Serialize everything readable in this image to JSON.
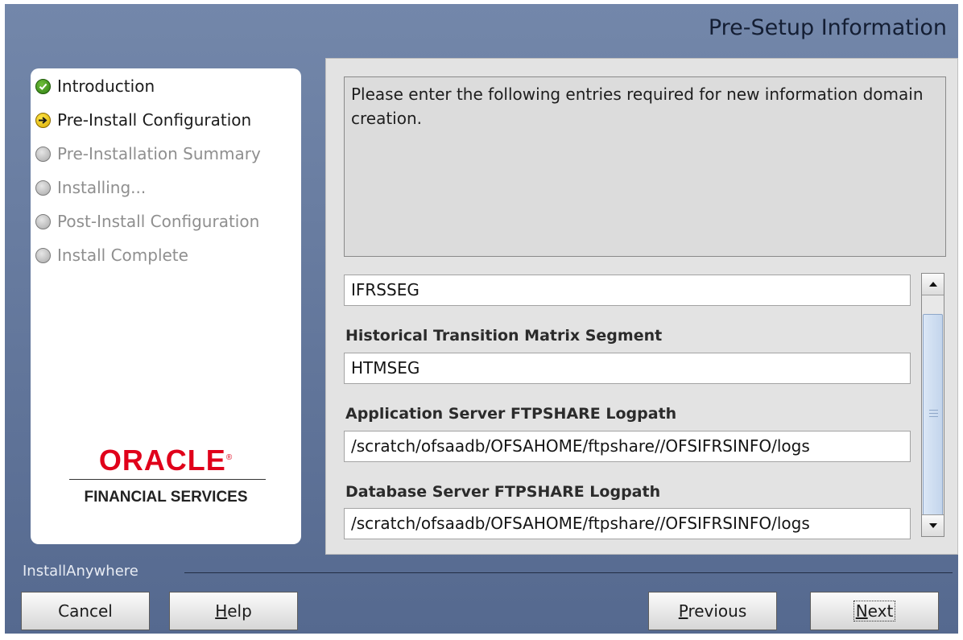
{
  "header": {
    "title": "Pre-Setup Information"
  },
  "steps": [
    {
      "label": "Introduction",
      "state": "done"
    },
    {
      "label": "Pre-Install Configuration",
      "state": "current"
    },
    {
      "label": "Pre-Installation Summary",
      "state": "pending"
    },
    {
      "label": "Installing...",
      "state": "pending"
    },
    {
      "label": "Post-Install Configuration",
      "state": "pending"
    },
    {
      "label": "Install Complete",
      "state": "pending"
    }
  ],
  "logo": {
    "brand": "ORACLE",
    "mark": "®",
    "subtitle": "FINANCIAL SERVICES"
  },
  "description": "Please enter the following entries required for new information domain creation.",
  "fields": [
    {
      "label": "",
      "value": "IFRSSEG"
    },
    {
      "label": "Historical Transition Matrix Segment",
      "value": "HTMSEG"
    },
    {
      "label": "Application Server FTPSHARE Logpath",
      "value": "/scratch/ofsaadb/OFSAHOME/ftpshare//OFSIFRSINFO/logs"
    },
    {
      "label": "Database Server FTPSHARE Logpath",
      "value": "/scratch/ofsaadb/OFSAHOME/ftpshare//OFSIFRSINFO/logs"
    }
  ],
  "footer": {
    "brand": "InstallAnywhere",
    "cancel": "Cancel",
    "help_mnemonic": "H",
    "help_rest": "elp",
    "previous_mnemonic": "P",
    "previous_rest": "revious",
    "next_mnemonic": "N",
    "next_rest": "ext"
  },
  "icons": {
    "step_done": "check-circle-icon",
    "step_current": "arrow-right-circle-icon",
    "step_pending": "empty-circle-icon",
    "scroll_up": "arrow-up-icon",
    "scroll_down": "arrow-down-icon"
  },
  "colors": {
    "accent": "#e0001a",
    "frame": "#6479a0"
  }
}
